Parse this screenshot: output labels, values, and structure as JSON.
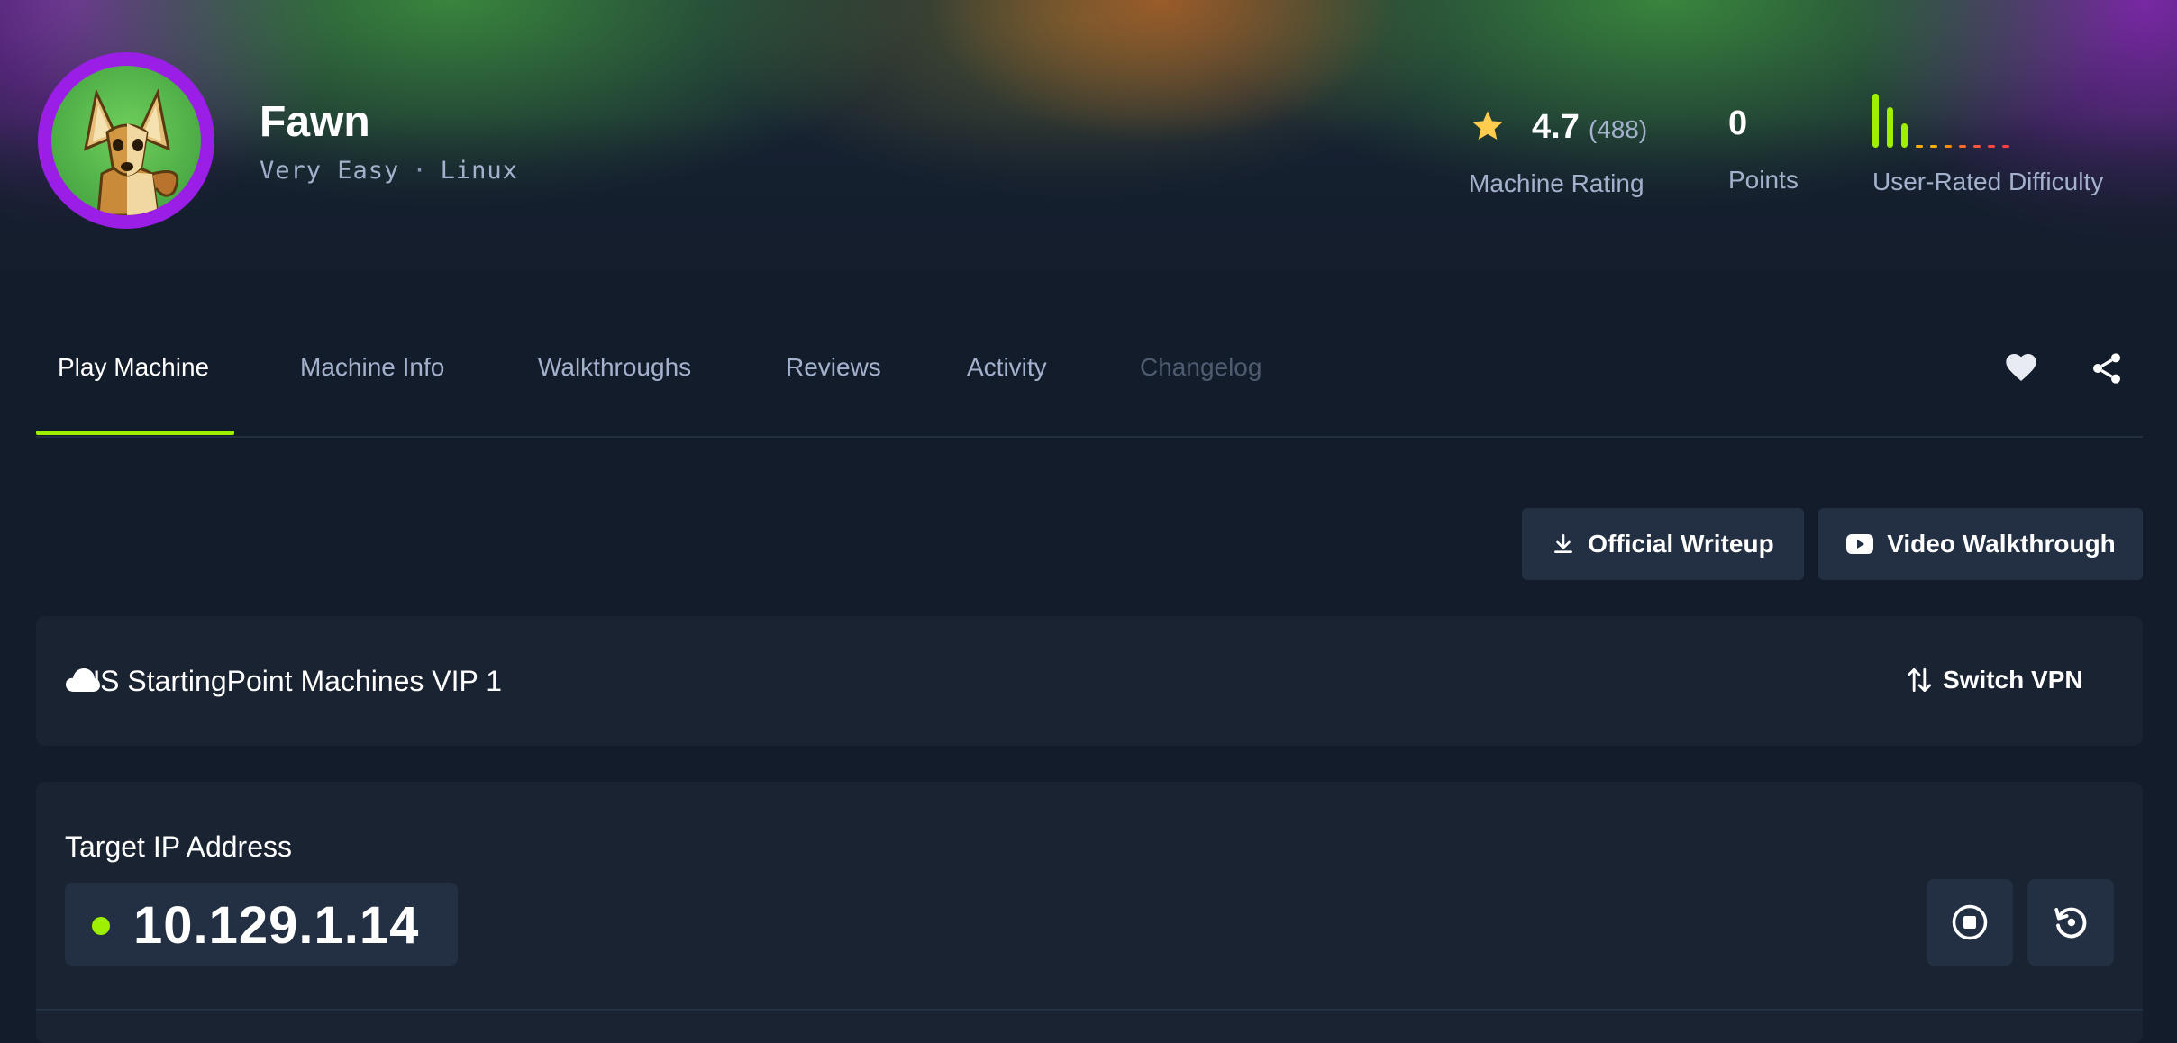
{
  "machine": {
    "name": "Fawn",
    "difficulty": "Very Easy",
    "separator": "·",
    "os": "Linux"
  },
  "stats": {
    "rating": {
      "value": "4.7",
      "count": "(488)",
      "label": "Machine Rating"
    },
    "points": {
      "value": "0",
      "label": "Points"
    },
    "user_difficulty": {
      "label": "User-Rated Difficulty",
      "distribution": [
        1.0,
        0.75,
        0.45,
        0.04,
        0.04,
        0.04,
        0.04,
        0.04,
        0.04,
        0.04
      ],
      "colors": [
        "#9fef00",
        "#9fef00",
        "#9fef00",
        "#ffaf00",
        "#ffaf00",
        "#ff8c00",
        "#ff6b30",
        "#ff5540",
        "#ff4444",
        "#ff3e3e"
      ]
    }
  },
  "tabs": [
    {
      "label": "Play Machine",
      "state": "active"
    },
    {
      "label": "Machine Info",
      "state": "normal"
    },
    {
      "label": "Walkthroughs",
      "state": "normal"
    },
    {
      "label": "Reviews",
      "state": "normal"
    },
    {
      "label": "Activity",
      "state": "normal"
    },
    {
      "label": "Changelog",
      "state": "disabled"
    }
  ],
  "tab_icons": [
    "heart-icon",
    "share-icon"
  ],
  "buttons": {
    "writeup": "Official Writeup",
    "video": "Video Walkthrough"
  },
  "vpn": {
    "server": "US StartingPoint Machines VIP 1",
    "switch_label": "Switch VPN"
  },
  "target": {
    "label": "Target IP Address",
    "ip": "10.129.1.14",
    "status_color": "#9fef00"
  },
  "colors": {
    "accent": "#9fef00",
    "background": "#131c2b",
    "panel": "#1a2332",
    "star": "#ffcc4d"
  }
}
